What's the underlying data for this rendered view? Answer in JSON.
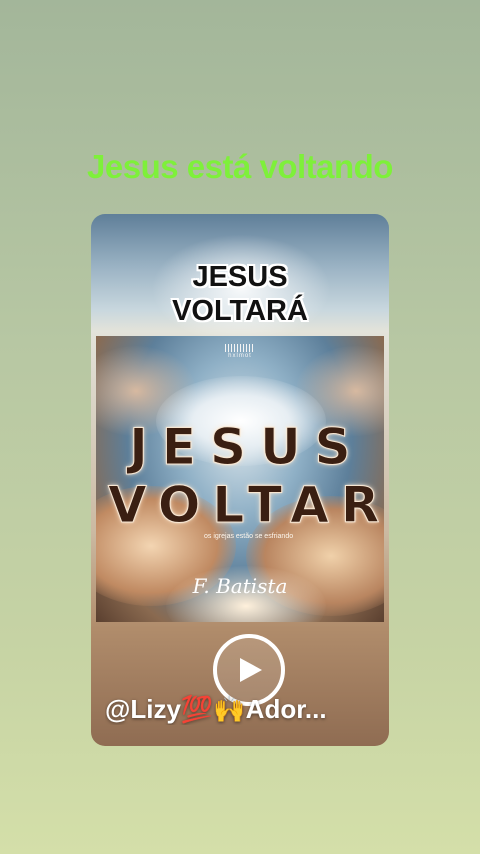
{
  "headline": "Jesus está voltando",
  "card": {
    "overlay_title_line1": "JESUS",
    "overlay_title_line2": "VOLTARÁ",
    "album": {
      "brand": "hxlmot",
      "title_line1": "JESUS",
      "title_line2": "VOLTARÁ",
      "subtitle": "os igrejas estão se esfriando",
      "signature": "F. Batista"
    },
    "play_icon": "play-icon",
    "username": "@Lizy💯🙌Ador..."
  },
  "colors": {
    "headline": "#7ef03a",
    "background_top": "#a3b69a",
    "background_bottom": "#d4dfa9"
  }
}
